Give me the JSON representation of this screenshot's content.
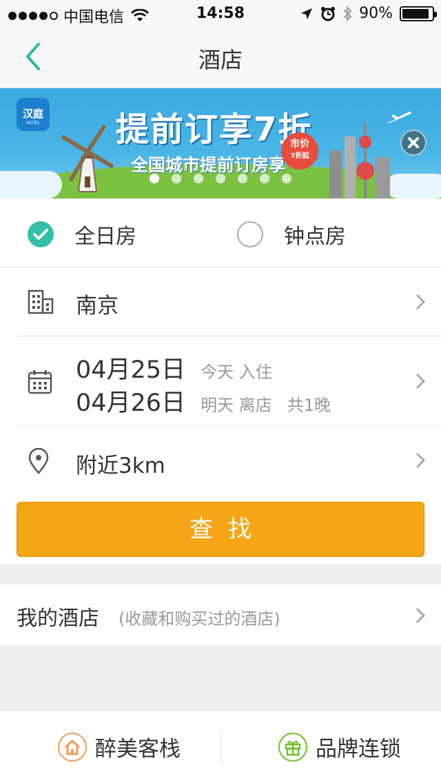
{
  "status_bar": {
    "carrier": "中国电信",
    "time": "14:58",
    "battery": "90%",
    "battery_level": 0.9,
    "signal_bars": 4
  },
  "nav": {
    "title": "酒店"
  },
  "banner": {
    "brand_name": "汉庭",
    "brand_sub": "HOTEL",
    "headline": "提前订享7折",
    "subline": "全国城市提前订房享",
    "badge_line1": "市价",
    "badge_line2": "7折起",
    "page_count": 7,
    "active_page": 0
  },
  "room_type": {
    "options": [
      {
        "label": "全日房",
        "selected": true
      },
      {
        "label": "钟点房",
        "selected": false
      }
    ]
  },
  "city": {
    "value": "南京"
  },
  "dates": {
    "checkin_date": "04月25日",
    "checkin_hint": "今天 入住",
    "checkout_date": "04月26日",
    "checkout_hint": "明天 离店",
    "nights": "共1晚"
  },
  "location": {
    "value": "附近3km"
  },
  "search": {
    "label": "查找"
  },
  "my_hotel": {
    "label": "我的酒店",
    "hint": "(收藏和购买过的酒店)"
  },
  "bottom_bar": {
    "left_label": "醉美客栈",
    "right_label": "品牌连锁"
  },
  "colors": {
    "accent": "#32bfa8",
    "button": "#f5a516",
    "left_icon": "#f39a55",
    "right_icon": "#6cc024"
  },
  "icons": [
    "back-chevron-icon",
    "wifi-icon",
    "location-arrow-icon",
    "alarm-icon",
    "bluetooth-icon",
    "battery-icon",
    "close-icon",
    "building-icon",
    "calendar-icon",
    "map-pin-icon",
    "chevron-right-icon",
    "house-icon",
    "gift-icon"
  ]
}
